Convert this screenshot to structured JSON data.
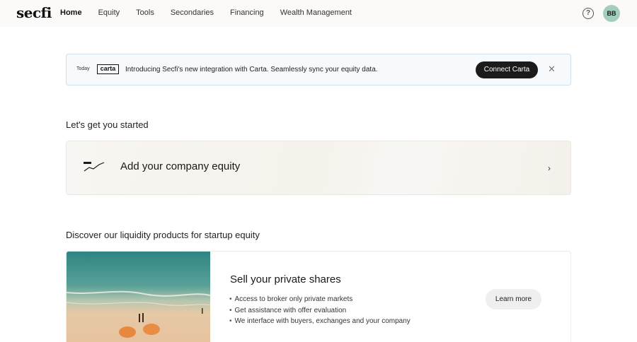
{
  "nav": {
    "logo": "secfi",
    "items": [
      {
        "label": "Home",
        "active": true
      },
      {
        "label": "Equity",
        "active": false
      },
      {
        "label": "Tools",
        "active": false
      },
      {
        "label": "Secondaries",
        "active": false
      },
      {
        "label": "Financing",
        "active": false
      },
      {
        "label": "Wealth Management",
        "active": false
      }
    ],
    "help_icon": "question-circle-icon",
    "help_glyph": "?",
    "avatar_initials": "BB"
  },
  "banner": {
    "date": "Today",
    "partner_logo": "carta",
    "message": "Introducing Secfi's new integration with Carta. Seamlessly sync your equity data.",
    "button_label": "Connect Carta",
    "close_icon": "close-icon",
    "close_glyph": "✕"
  },
  "getting_started": {
    "heading": "Let's get you started",
    "card_title": "Add your company equity",
    "card_icon": "line-chart-icon",
    "chevron_icon": "chevron-right-icon",
    "chevron_glyph": "›"
  },
  "liquidity": {
    "heading": "Discover our liquidity products for startup equity",
    "card_title": "Sell your private shares",
    "bullets": [
      "Access to broker only private markets",
      "Get assistance with offer evaluation",
      "We interface with buyers, exchanges and your company"
    ],
    "button_label": "Learn more",
    "image": "beach-aerial-photo"
  },
  "colors": {
    "avatar_bg": "#a3cdbd",
    "primary_button": "#1b1b1b",
    "banner_border": "#cfe0ee"
  }
}
